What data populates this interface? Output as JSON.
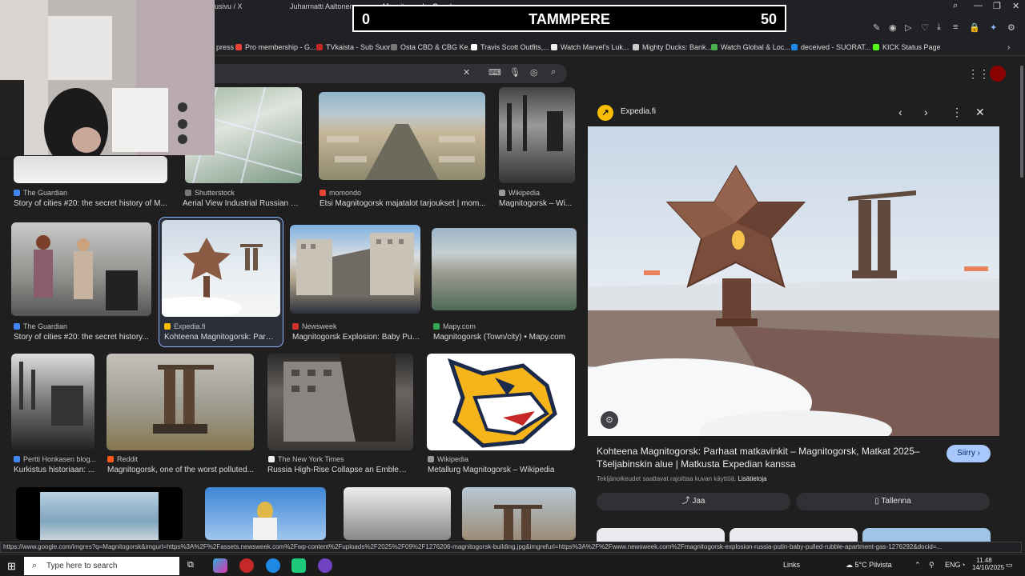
{
  "browser": {
    "tabs": [
      "Juharmatti Aaltonen",
      "Magnitogorsk - Google",
      "usivu / X"
    ]
  },
  "scoreboard": {
    "left": "0",
    "title": "TAMMPERE",
    "right": "50"
  },
  "bookmarks": [
    {
      "label": "press",
      "color": "#888"
    },
    {
      "label": "Pro membership - G...",
      "color": "#ea4335"
    },
    {
      "label": "TVkaista - Sub Suora",
      "color": "#c62828"
    },
    {
      "label": "Osta CBD & CBG Ke...",
      "color": "#777"
    },
    {
      "label": "Travis Scott Outfits,...",
      "color": "#fff"
    },
    {
      "label": "Watch Marvel's Luk...",
      "color": "#eee"
    },
    {
      "label": "Mighty Ducks: Bank...",
      "color": "#ccc"
    },
    {
      "label": "Watch Global & Loc...",
      "color": "#4caf50"
    },
    {
      "label": "deceived - SUORAT...",
      "color": "#1e88e5"
    },
    {
      "label": "KICK Status Page",
      "color": "#111"
    }
  ],
  "results": [
    {
      "source": "The Guardian",
      "caption": "Story of cities #20: the secret history of M...",
      "fav": "#4285f4"
    },
    {
      "source": "Shutterstock",
      "caption": "Aerial View Industrial Russian Cit...",
      "fav": "#777"
    },
    {
      "source": "momondo",
      "caption": "Etsi Magnitogorsk majatalot tarjoukset | mom...",
      "fav": "#ea4335"
    },
    {
      "source": "Wikipedia",
      "caption": "Magnitogorsk – Wi...",
      "fav": "#999"
    },
    {
      "source": "The Guardian",
      "caption": "Story of cities #20: the secret history...",
      "fav": "#4285f4"
    },
    {
      "source": "Expedia.fi",
      "caption": "Kohteena Magnitogorsk: Parh...",
      "fav": "#fbbc04"
    },
    {
      "source": "Newsweek",
      "caption": "Magnitogorsk Explosion: Baby Pull...",
      "fav": "#d32f2f"
    },
    {
      "source": "Mapy.com",
      "caption": "Magnitogorsk (Town/city) • Mapy.com",
      "fav": "#34a853"
    },
    {
      "source": "Pertti Honkasen blog...",
      "caption": "Kurkistus historiaan: ...",
      "fav": "#4285f4"
    },
    {
      "source": "Reddit",
      "caption": "Magnitogorsk, one of the worst polluted...",
      "fav": "#ff5722"
    },
    {
      "source": "The New York Times",
      "caption": "Russia High-Rise Collapse an Emblem ...",
      "fav": "#eee"
    },
    {
      "source": "Wikipedia",
      "caption": "Metallurg Magnitogorsk – Wikipedia",
      "fav": "#999"
    }
  ],
  "panel": {
    "source": "Expedia.fi",
    "title": "Kohteena Magnitogorsk: Parhaat matkavinkit – Magnitogorsk, Matkat 2025– Tšeljabinskin alue | Matkusta Expedian kanssa",
    "note": "Tekijänoikeudet saattavat rajoittaa kuvan käyttöä.",
    "note_link": "Lisätietoja",
    "visit": "Siirry",
    "share": "Jaa",
    "save": "Tallenna"
  },
  "status_url": "https://www.google.com/imgres?q=Magnitogorsk&imgurl=https%3A%2F%2Fassets.newsweek.com%2Fwp-content%2Fuploads%2F2025%2F09%2F1276206-magnitogorsk-building.jpg&imgrefurl=https%3A%2F%2Fwww.newsweek.com%2Fmagnitogorsk-explosion-russia-putin-baby-pulled-rubble-apartment-gas-1276292&docid=...",
  "taskbar": {
    "search_placeholder": "Type here to search",
    "links": "Links",
    "weather": "5°C Pilvista",
    "lang": "ENG",
    "time": "11.48",
    "date": "14/10/2025"
  },
  "colors": {
    "accent": "#8ab4f8",
    "visit_bg": "#a8c7fa"
  }
}
